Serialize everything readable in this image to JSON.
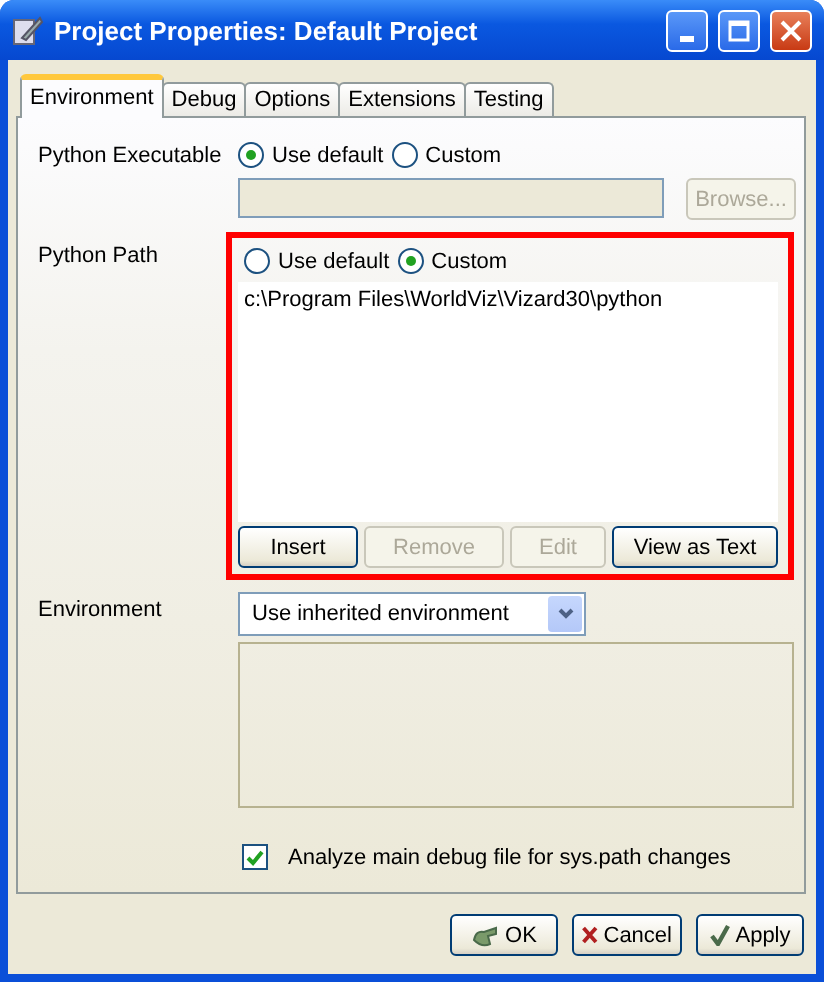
{
  "window": {
    "title": "Project Properties: Default Project"
  },
  "tabs": [
    {
      "label": "Environment",
      "selected": true
    },
    {
      "label": "Debug",
      "selected": false
    },
    {
      "label": "Options",
      "selected": false
    },
    {
      "label": "Extensions",
      "selected": false
    },
    {
      "label": "Testing",
      "selected": false
    }
  ],
  "python_executable": {
    "label": "Python Executable",
    "options": [
      {
        "label": "Use default",
        "selected": true
      },
      {
        "label": "Custom",
        "selected": false
      }
    ],
    "browse_button": {
      "label": "Browse...",
      "disabled": true
    }
  },
  "python_path": {
    "label": "Python Path",
    "options": [
      {
        "label": "Use default",
        "selected": false
      },
      {
        "label": "Custom",
        "selected": true
      }
    ],
    "entries": [
      "c:\\Program Files\\WorldViz\\Vizard30\\python"
    ],
    "buttons": [
      {
        "label": "Insert",
        "disabled": false
      },
      {
        "label": "Remove",
        "disabled": true
      },
      {
        "label": "Edit",
        "disabled": true
      },
      {
        "label": "View as Text",
        "disabled": false
      }
    ]
  },
  "environment": {
    "label": "Environment",
    "select": {
      "value": "Use inherited environment"
    }
  },
  "analyze": {
    "label": "Analyze main debug file for sys.path changes",
    "checked": true
  },
  "buttons": [
    {
      "label": "OK",
      "kind": "ok"
    },
    {
      "label": "Cancel",
      "kind": "cancel"
    },
    {
      "label": "Apply",
      "kind": "apply"
    }
  ]
}
